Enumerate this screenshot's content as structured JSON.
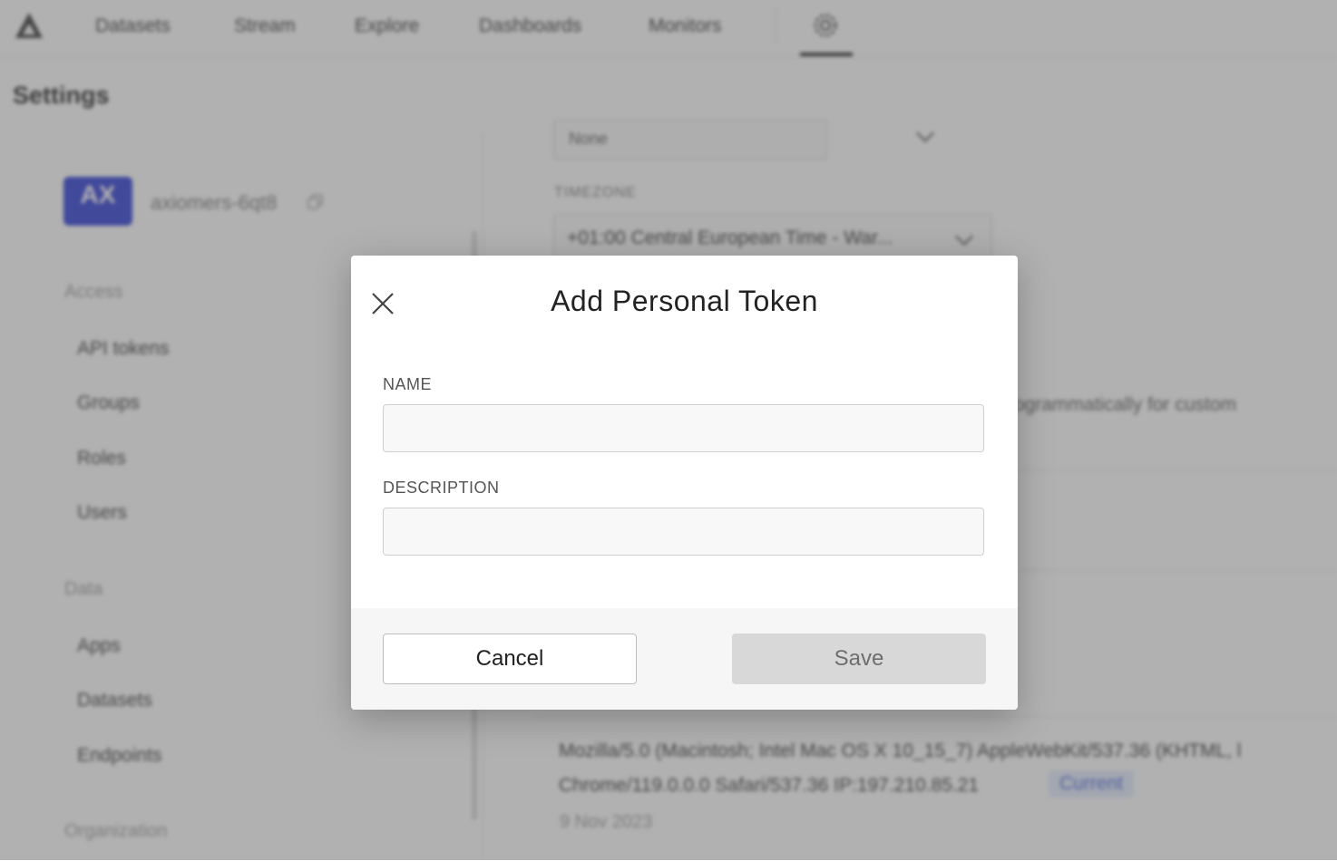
{
  "nav": {
    "items": [
      "Datasets",
      "Stream",
      "Explore",
      "Dashboards",
      "Monitors"
    ]
  },
  "page": {
    "title": "Settings"
  },
  "sidebar": {
    "org": {
      "avatar_initials": "AX",
      "name": "axiomers-6qt8"
    },
    "sections": [
      {
        "title": "Access",
        "items": [
          "API tokens",
          "Groups",
          "Roles",
          "Users"
        ]
      },
      {
        "title": "Data",
        "items": [
          "Apps",
          "Datasets",
          "Endpoints"
        ]
      },
      {
        "title": "Organization"
      }
    ]
  },
  "main": {
    "select_value": "None",
    "timezone_label": "TIMEZONE",
    "timezone_value": "+01:00 Central European Time - War...",
    "api_desc": "ogrammatically for custom",
    "session": {
      "ua_line1": "Mozilla/5.0 (Macintosh; Intel Mac OS X 10_15_7) AppleWebKit/537.36 (KHTML, l",
      "ua_line2": "Chrome/119.0.0.0 Safari/537.36 IP:197.210.85.21",
      "badge": "Current",
      "date": "9 Nov 2023"
    }
  },
  "modal": {
    "title": "Add Personal Token",
    "name_label": "NAME",
    "name_value": "",
    "description_label": "DESCRIPTION",
    "description_value": "",
    "cancel_label": "Cancel",
    "save_label": "Save"
  },
  "colors": {
    "accent": "#2d3bd6",
    "save_disabled_bg": "#d8d8d8",
    "overlay": "#5a5a5a"
  }
}
